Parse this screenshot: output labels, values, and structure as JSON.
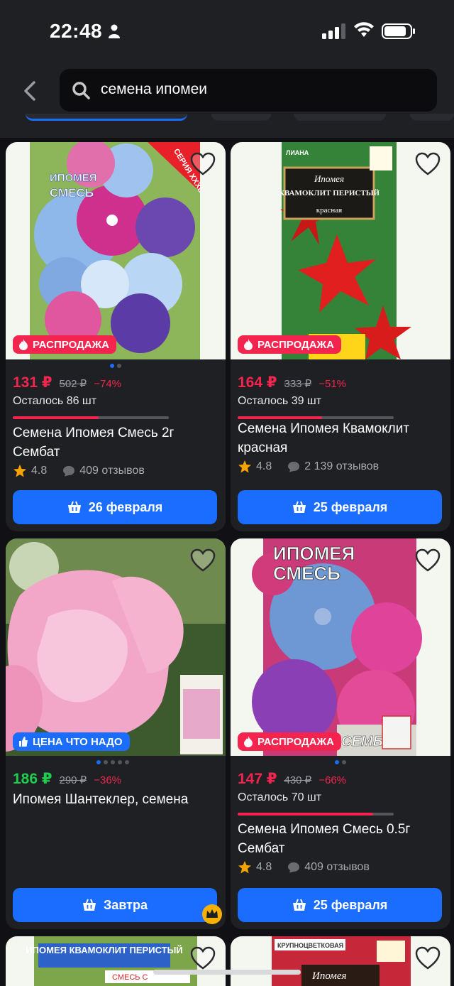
{
  "status_bar": {
    "time": "22:48"
  },
  "search": {
    "query": "семена ипомеи"
  },
  "colors": {
    "accent": "#1a6dff",
    "sale": "#f3254f",
    "green_price": "#1fcc4e",
    "card_bg": "#1f2024"
  },
  "products": [
    {
      "badge": "РАСПРОДАЖА",
      "image_labels": [
        "ИПОМЕЯ",
        "СМЕСЬ",
        "СЕРИЯ XXXL"
      ],
      "price": "131 ₽",
      "old_price": "502 ₽",
      "discount": "−74%",
      "stock": "Осталось 86 шт",
      "stock_level": 0.55,
      "title": "Семена Ипомея Смесь 2г Сембат",
      "rating": "4.8",
      "reviews": "409 отзывов",
      "delivery": "26 февраля"
    },
    {
      "badge": "РАСПРОДАЖА",
      "image_labels": [
        "ЛИАНА",
        "Ипомея",
        "КВАМОКЛИТ ПЕРИСТЫЙ",
        "красная"
      ],
      "price": "164 ₽",
      "old_price": "333 ₽",
      "discount": "−51%",
      "stock": "Осталось 39 шт",
      "stock_level": 0.54,
      "title": "Семена Ипомея Квамоклит красная",
      "rating": "4.8",
      "reviews": "2 139 отзывов",
      "delivery": "25 февраля"
    },
    {
      "badge": "ЦЕНА ЧТО НАДО",
      "image_labels": [],
      "price": "186 ₽",
      "old_price": "290 ₽",
      "discount": "−36%",
      "title": "Ипомея Шантеклер, семена",
      "delivery": "Завтра"
    },
    {
      "badge": "РАСПРОДАЖА",
      "image_labels": [
        "ИПОМЕЯ",
        "СМЕСЬ",
        "СЕМБАТ"
      ],
      "price": "147 ₽",
      "old_price": "430 ₽",
      "discount": "−66%",
      "stock": "Осталось 70 шт",
      "stock_level": 0.87,
      "title": "Семена Ипомея Смесь 0.5г Сембат",
      "rating": "4.8",
      "reviews": "409 отзывов",
      "delivery": "25 февраля"
    },
    {
      "image_labels": [
        "ИПОМЕЯ КВАМОКЛИТ ПЕРИСТЫЙ",
        "СМЕСЬ С"
      ]
    },
    {
      "image_labels": [
        "КРУПНОЦВЕТКОВАЯ",
        "Ипомея"
      ]
    }
  ]
}
